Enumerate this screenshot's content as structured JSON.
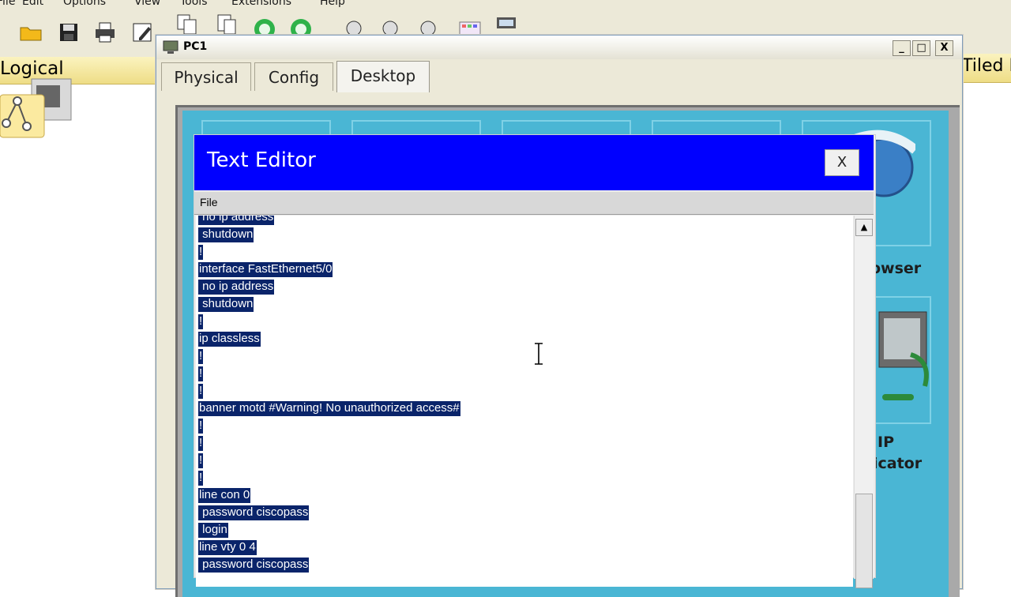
{
  "main_app": {
    "menu": [
      "File",
      "Edit",
      "Options",
      "View",
      "Tools",
      "Extensions",
      "Help"
    ],
    "toolbar_icons": [
      "folder-icon",
      "save-icon",
      "print-icon",
      "edit-icon",
      "copy-icon",
      "paste-icon",
      "undo-icon",
      "redo-icon",
      "zoom-in-icon",
      "zoom-reset-icon",
      "zoom-out-icon",
      "palette-icon",
      "device-dialog-icon"
    ],
    "logical_label": "Logical",
    "tiled_label": "Tiled E"
  },
  "pc1_window": {
    "title": "PC1",
    "controls": {
      "minimize": "_",
      "maximize": "□",
      "close": "X"
    },
    "tabs": [
      {
        "label": "Physical",
        "active": false
      },
      {
        "label": "Config",
        "active": false
      },
      {
        "label": "Desktop",
        "active": true
      }
    ],
    "desktop_apps": {
      "web_browser_label": "owser",
      "ip_communicator_label_1": "IP",
      "ip_communicator_label_2": "icator"
    }
  },
  "text_editor": {
    "title": "Text Editor",
    "close_label": "X",
    "menu_file": "File",
    "selection_color": "#0a246a",
    "lines": [
      " no ip address",
      " shutdown",
      "!",
      "interface FastEthernet5/0",
      " no ip address",
      " shutdown",
      "!",
      "ip classless",
      "!",
      "!",
      "!",
      "banner motd #Warning! No unauthorized access#",
      "!",
      "!",
      "!",
      "!",
      "line con 0",
      " password ciscopass",
      " login",
      "line vty 0 4",
      " password ciscopass"
    ],
    "scroll_up_arrow": "▲"
  }
}
